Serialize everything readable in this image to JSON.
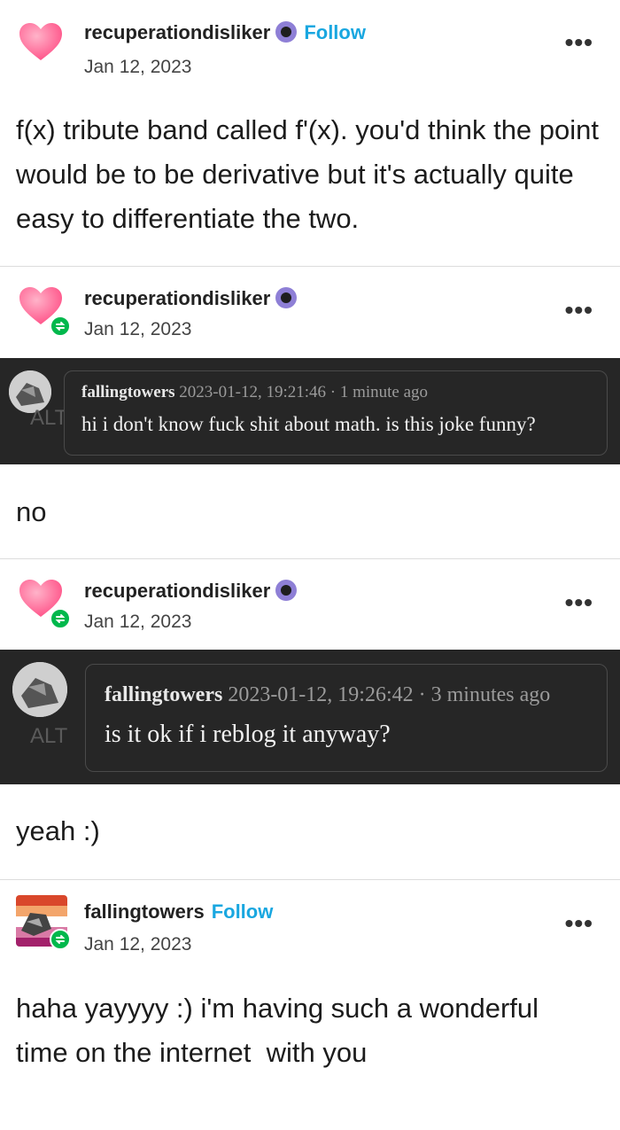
{
  "posts": [
    {
      "username": "recuperationdisliker",
      "follow_label": "Follow",
      "date": "Jan 12, 2023",
      "text": "f(x) tribute band called f'(x). you'd think the point would be to be derivative but it's actually quite easy to differentiate the two."
    },
    {
      "username": "recuperationdisliker",
      "date": "Jan 12, 2023",
      "message": {
        "sender": "fallingtowers",
        "timestamp": "2023-01-12, 19:21:46",
        "ago": "1 minute ago",
        "text": "hi i don't know fuck shit about math. is this joke funny?",
        "alt": "ALT"
      },
      "text": "no"
    },
    {
      "username": "recuperationdisliker",
      "date": "Jan 12, 2023",
      "message": {
        "sender": "fallingtowers",
        "timestamp": "2023-01-12, 19:26:42",
        "ago": "3 minutes ago",
        "text": "is it ok if i reblog it anyway?",
        "alt": "ALT"
      },
      "text": "yeah :)"
    },
    {
      "username": "fallingtowers",
      "follow_label": "Follow",
      "date": "Jan 12, 2023",
      "text_line1": "haha yayyyy :) i'm having such a wonderful",
      "text_line2": "time on the internet  with you"
    }
  ],
  "more_label": "•••",
  "meta_sep": "·",
  "colors": {
    "follow": "#19a7e0",
    "reblog_badge": "#00b84c",
    "dark_block": "#262626",
    "heart": "#ff5f8f"
  }
}
